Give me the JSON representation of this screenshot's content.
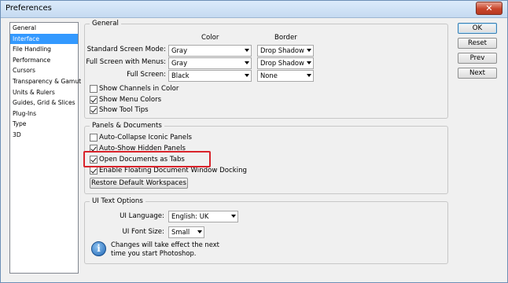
{
  "window": {
    "title": "Preferences",
    "close_glyph": "✕"
  },
  "sidebar": {
    "items": [
      {
        "label": "General"
      },
      {
        "label": "Interface",
        "selected": true
      },
      {
        "label": "File Handling"
      },
      {
        "label": "Performance"
      },
      {
        "label": "Cursors"
      },
      {
        "label": "Transparency & Gamut"
      },
      {
        "label": "Units & Rulers"
      },
      {
        "label": "Guides, Grid & Slices"
      },
      {
        "label": "Plug-Ins"
      },
      {
        "label": "Type"
      },
      {
        "label": "3D"
      }
    ]
  },
  "general": {
    "legend": "General",
    "col_color": "Color",
    "col_border": "Border",
    "rows": [
      {
        "label": "Standard Screen Mode:",
        "color": "Gray",
        "border": "Drop Shadow"
      },
      {
        "label": "Full Screen with Menus:",
        "color": "Gray",
        "border": "Drop Shadow"
      },
      {
        "label": "Full Screen:",
        "color": "Black",
        "border": "None"
      }
    ],
    "checks": [
      {
        "label": "Show Channels in Color",
        "checked": false
      },
      {
        "label": "Show Menu Colors",
        "checked": true
      },
      {
        "label": "Show Tool Tips",
        "checked": true
      }
    ]
  },
  "panels": {
    "legend": "Panels & Documents",
    "checks": [
      {
        "label": "Auto-Collapse Iconic Panels",
        "checked": false
      },
      {
        "label": "Auto-Show Hidden Panels",
        "checked": true
      },
      {
        "label": "Open Documents as Tabs",
        "checked": true
      },
      {
        "label": "Enable Floating Document Window Docking",
        "checked": true
      }
    ],
    "restore_button": "Restore Default Workspaces"
  },
  "ui_text": {
    "legend": "UI Text Options",
    "language_label": "UI Language:",
    "language_value": "English: UK",
    "font_size_label": "UI Font Size:",
    "font_size_value": "Small",
    "note_line1": "Changes will take effect the next",
    "note_line2": "time you start Photoshop."
  },
  "buttons": {
    "ok": "OK",
    "reset": "Reset",
    "prev": "Prev",
    "next": "Next"
  },
  "colors": {
    "highlight": "#d9232b",
    "selection": "#3399ff"
  }
}
